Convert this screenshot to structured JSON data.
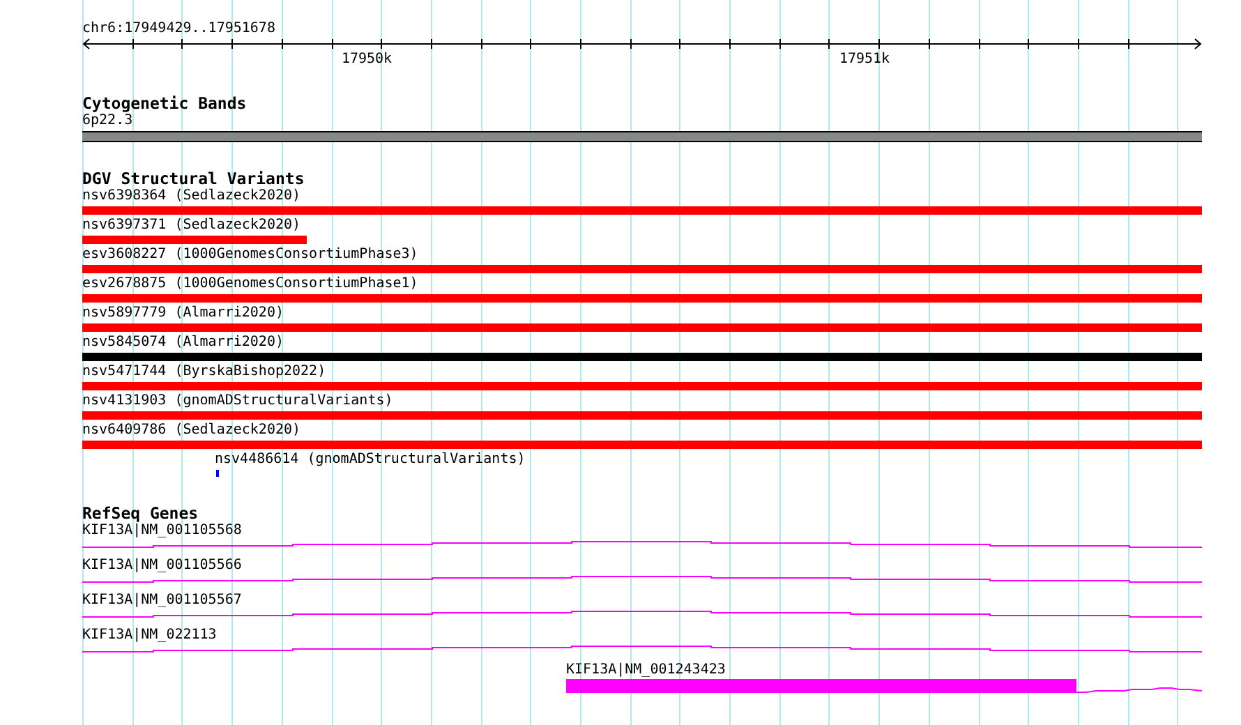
{
  "ruler": {
    "position": "chr6:17949429..17951678",
    "tick_labels": [
      "17950k",
      "17951k"
    ]
  },
  "tracks": [
    {
      "title": "Cytogenetic Bands",
      "features": [
        {
          "kind": "band",
          "label": "6p22.3"
        }
      ]
    },
    {
      "title": "DGV Structural Variants",
      "features": [
        {
          "kind": "bar",
          "label": "nsv6398364 (Sedlazeck2020)",
          "color": "#ff0000"
        },
        {
          "kind": "bar",
          "label": "nsv6397371 (Sedlazeck2020)",
          "color": "#ff0000",
          "level": 0.2
        },
        {
          "kind": "bar",
          "label": "esv3608227 (1000GenomesConsortiumPhase3)",
          "color": "#ff0000"
        },
        {
          "kind": "bar",
          "label": "esv2678875 (1000GenomesConsortiumPhase1)",
          "color": "#ff0000"
        },
        {
          "kind": "bar",
          "label": "nsv5897779 (Almarri2020)",
          "color": "#ff0000"
        },
        {
          "kind": "bar",
          "label": "nsv5845074 (Almarri2020)",
          "color": "#000000"
        },
        {
          "kind": "bar",
          "label": "nsv5471744 (ByrskaBishop2022)",
          "color": "#ff0000"
        },
        {
          "kind": "bar",
          "label": "nsv4131903 (gnomADStructuralVariants)",
          "color": "#ff0000"
        },
        {
          "kind": "bar",
          "label": "nsv6409786 (Sedlazeck2020)",
          "color": "#ff0000"
        },
        {
          "kind": "point",
          "label": "nsv4486614 (gnomADStructuralVariants)",
          "color": "#0000ff"
        }
      ]
    },
    {
      "title": "RefSeq Genes",
      "features": [
        {
          "kind": "transcript",
          "label": "KIF13A|NM_001105568"
        },
        {
          "kind": "transcript",
          "label": "KIF13A|NM_001105566"
        },
        {
          "kind": "transcript",
          "label": "KIF13A|NM_001105567"
        },
        {
          "kind": "transcript",
          "label": "KIF13A|NM_022113"
        },
        {
          "kind": "partial-gene",
          "label": "KIF13A|NM_001243423"
        }
      ]
    }
  ]
}
